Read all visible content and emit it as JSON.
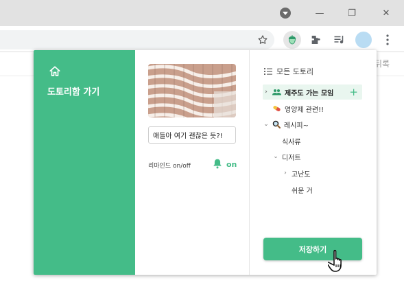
{
  "browser": {
    "window_controls": {
      "minimize": "—",
      "maximize": "❐",
      "close": "✕"
    },
    "extension_icons": [
      "star-icon",
      "acorn-extension-icon",
      "puzzle-extension-icon",
      "media-queue-icon",
      "profile-avatar",
      "kebab-menu-icon"
    ],
    "page_background_text": "뒤록"
  },
  "popup": {
    "sidebar": {
      "home_label": "도토리함 가기",
      "icon": "home-icon",
      "color": "#44bc88"
    },
    "preview": {
      "memo_value": "애들아 여기 괜찮은 듯?!",
      "reminder_label": "리마인드 on/off",
      "reminder_state": "on"
    },
    "folders": {
      "header": "모든 도토리",
      "items": [
        {
          "label": "제주도 가는 모임",
          "icon": "people-icon",
          "chevron": "›",
          "selected": true,
          "action": "+"
        },
        {
          "label": "영양제 관련!!",
          "icon": "pill-icon",
          "chevron": ""
        },
        {
          "label": "레시피~",
          "icon": "magnifier-icon",
          "chevron": "⌄"
        },
        {
          "label": "식사류",
          "chevron": ""
        },
        {
          "label": "디저트",
          "chevron": "⌄"
        },
        {
          "label": "고난도",
          "chevron": "›"
        },
        {
          "label": "쉬운 거",
          "chevron": ""
        }
      ]
    },
    "save_button": "저장하기"
  }
}
